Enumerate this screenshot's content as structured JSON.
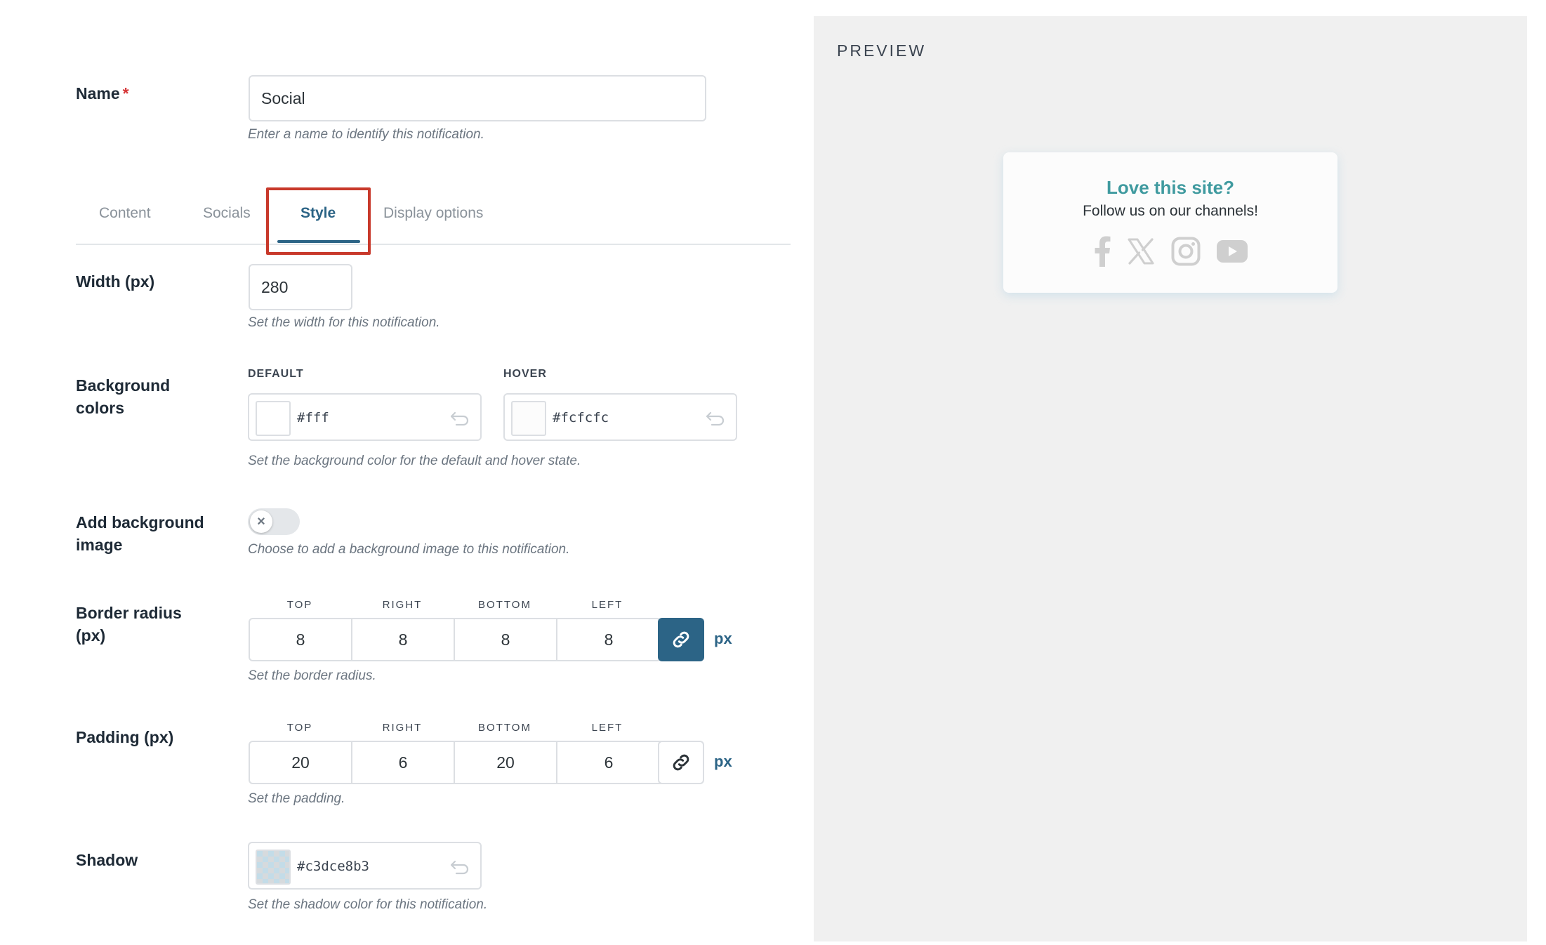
{
  "name_field": {
    "label": "Name",
    "required_mark": "*",
    "value": "Social",
    "help": "Enter a name to identify this notification."
  },
  "tabs": [
    {
      "label": "Content",
      "active": false
    },
    {
      "label": "Socials",
      "active": false
    },
    {
      "label": "Style",
      "active": true
    },
    {
      "label": "Display options",
      "active": false
    }
  ],
  "width_field": {
    "label": "Width (px)",
    "value": "280",
    "help": "Set the width for this notification."
  },
  "background_colors": {
    "label_line1": "Background",
    "label_line2": "colors",
    "default_label": "DEFAULT",
    "default_value": "#fff",
    "hover_label": "HOVER",
    "hover_value": "#fcfcfc",
    "help": "Set the background color for the default and hover state."
  },
  "background_image": {
    "label_line1": "Add background",
    "label_line2": "image",
    "toggle_symbol": "×",
    "enabled": false,
    "help": "Choose to add a background image to this notification."
  },
  "border_radius": {
    "label_line1": "Border radius",
    "label_line2": "(px)",
    "sides": [
      {
        "label": "TOP",
        "value": "8"
      },
      {
        "label": "RIGHT",
        "value": "8"
      },
      {
        "label": "BOTTOM",
        "value": "8"
      },
      {
        "label": "LEFT",
        "value": "8"
      }
    ],
    "linked": true,
    "unit": "px",
    "help": "Set the border radius."
  },
  "padding": {
    "label": "Padding (px)",
    "sides": [
      {
        "label": "TOP",
        "value": "20"
      },
      {
        "label": "RIGHT",
        "value": "6"
      },
      {
        "label": "BOTTOM",
        "value": "20"
      },
      {
        "label": "LEFT",
        "value": "6"
      }
    ],
    "linked": false,
    "unit": "px",
    "help": "Set the padding."
  },
  "shadow": {
    "label": "Shadow",
    "value": "#c3dce8b3",
    "help": "Set the shadow color for this notification."
  },
  "preview": {
    "title": "PREVIEW",
    "notification": {
      "title": "Love this site?",
      "subtitle": "Follow us on our channels!",
      "icons": [
        "facebook-icon",
        "x-icon",
        "instagram-icon",
        "youtube-icon"
      ]
    }
  },
  "colors": {
    "accent": "#2c6486",
    "highlight": "#c8392b",
    "notif_title": "#3f9a9f",
    "preview_bg": "#f0f0f0"
  }
}
